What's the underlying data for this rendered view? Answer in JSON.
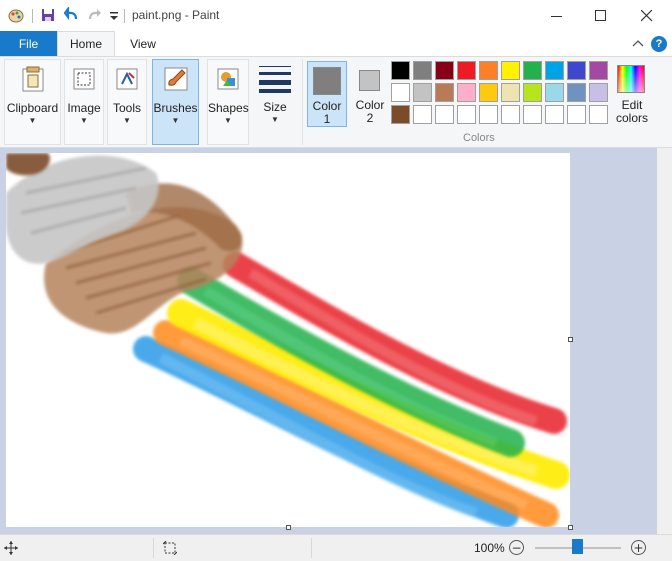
{
  "window": {
    "title": "paint.png - Paint",
    "title_separator": "|"
  },
  "tabs": {
    "file": "File",
    "home": "Home",
    "view": "View"
  },
  "ribbon": {
    "clipboard": "Clipboard",
    "image": "Image",
    "tools": "Tools",
    "brushes": "Brushes",
    "shapes": "Shapes",
    "size": "Size",
    "color1": "Color 1",
    "color1_line1": "Color",
    "color1_line2": "1",
    "color2_line1": "Color",
    "color2_line2": "2",
    "edit_colors_line1": "Edit",
    "edit_colors_line2": "colors",
    "colors_group": "Colors",
    "active_tool": "Brushes"
  },
  "palette": {
    "row1": [
      "#000000",
      "#7f7f7f",
      "#880015",
      "#ed1c24",
      "#ff7f27",
      "#fff200",
      "#22b14c",
      "#00a2e8",
      "#3f48cc",
      "#a349a4"
    ],
    "row2": [
      "#ffffff",
      "#c3c3c3",
      "#b97a57",
      "#ffaec9",
      "#ffc90e",
      "#efe4b0",
      "#b5e61d",
      "#99d9ea",
      "#7092be",
      "#c8bfe7"
    ],
    "row3": [
      "#7b4b2a",
      "#ffffff",
      "#ffffff",
      "#ffffff",
      "#ffffff",
      "#ffffff",
      "#ffffff",
      "#ffffff",
      "#ffffff",
      "#ffffff"
    ],
    "color1": "#7f7f7f",
    "color2": "#c3c3c3"
  },
  "status": {
    "zoom": "100%"
  },
  "colors": {
    "accent": "#1979ca",
    "workspace": "#c8d2e4"
  }
}
